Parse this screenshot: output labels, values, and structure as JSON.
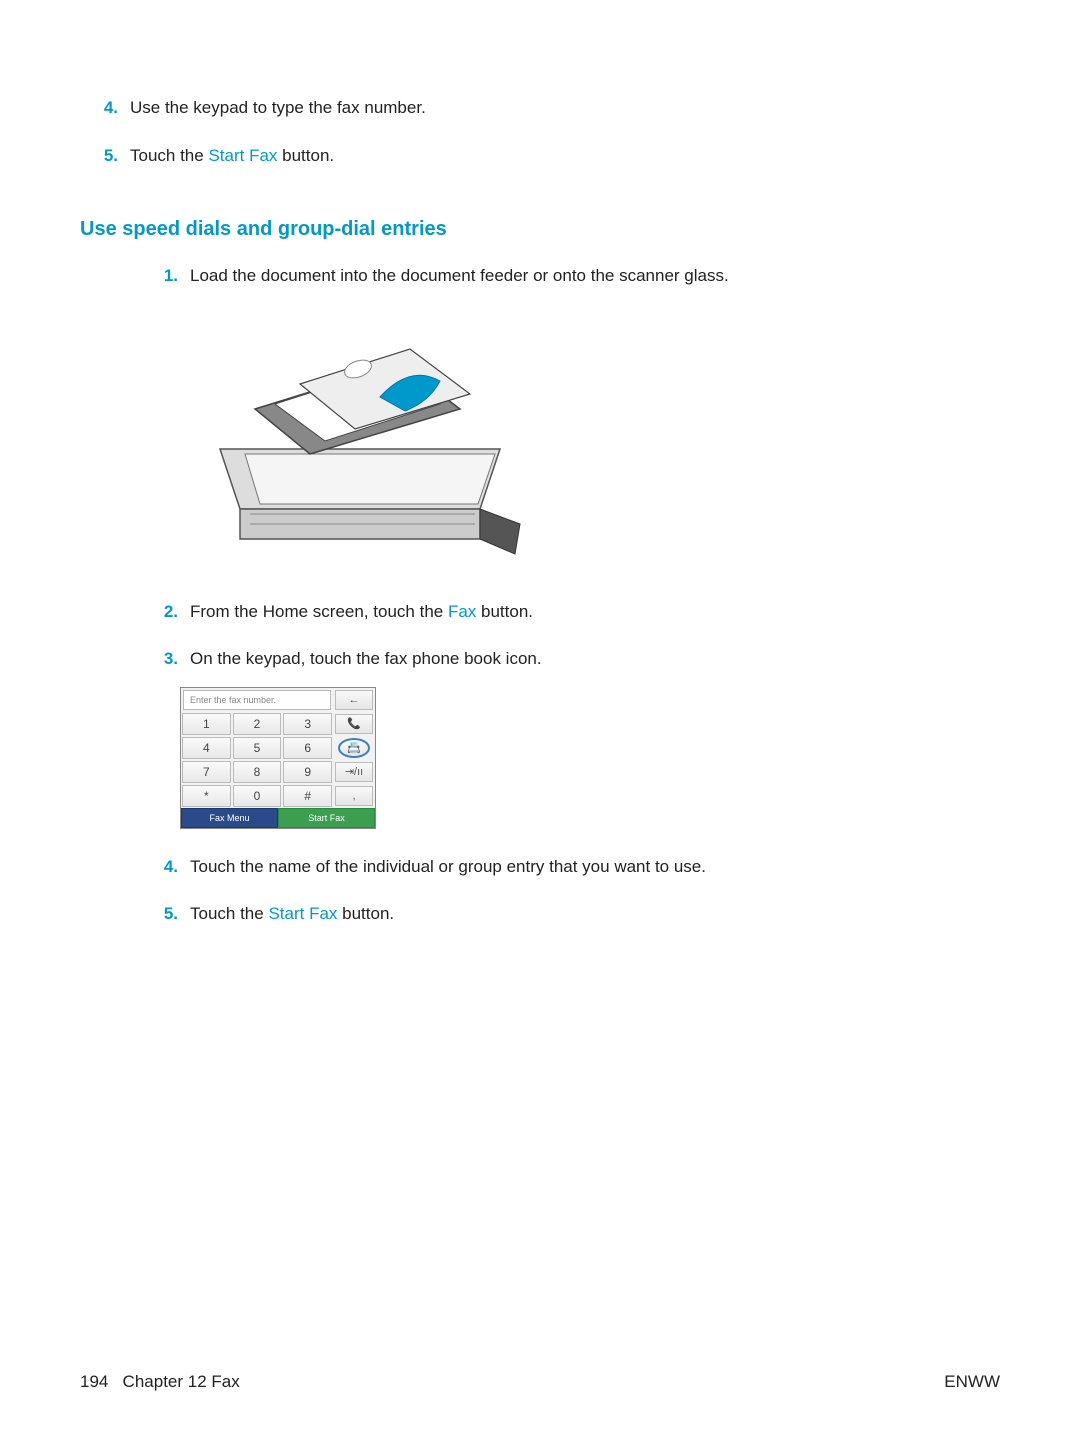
{
  "top_steps": [
    {
      "n": "4.",
      "text": "Use the keypad to type the fax number."
    },
    {
      "n": "5.",
      "pre": "Touch the ",
      "link": "Start Fax",
      "post": " button."
    }
  ],
  "section_title": "Use speed dials and group-dial entries",
  "steps": [
    {
      "n": "1.",
      "text": "Load the document into the document feeder or onto the scanner glass."
    },
    {
      "n": "2.",
      "pre": "From the Home screen, touch the ",
      "link": "Fax",
      "post": " button."
    },
    {
      "n": "3.",
      "text": "On the keypad, touch the fax phone book icon."
    },
    {
      "n": "4.",
      "text": "Touch the name of the individual or group entry that you want to use."
    },
    {
      "n": "5.",
      "pre": "Touch the ",
      "link": "Start Fax",
      "post": " button."
    }
  ],
  "keypad": {
    "placeholder": "Enter the fax number.",
    "back_arrow": "←",
    "rows": [
      [
        "1",
        "2",
        "3"
      ],
      [
        "4",
        "5",
        "6"
      ],
      [
        "7",
        "8",
        "9"
      ],
      [
        "*",
        "0",
        "#"
      ]
    ],
    "side_icons": [
      "📞",
      "📇",
      "⇥/ıı",
      ","
    ],
    "btn_left": "Fax Menu",
    "btn_right": "Start Fax"
  },
  "footer": {
    "page_num": "194",
    "chapter": "Chapter 12   Fax",
    "right": "ENWW"
  }
}
